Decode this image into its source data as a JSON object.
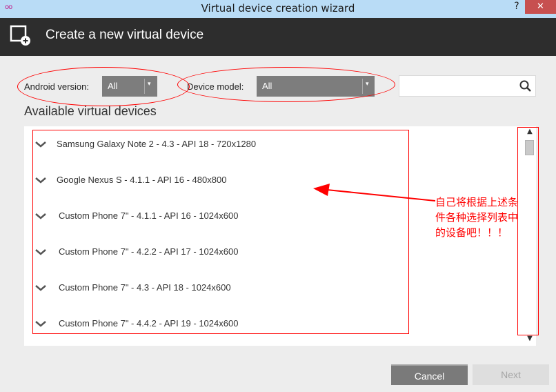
{
  "window": {
    "app_icon": "oo",
    "title": "Virtual device creation wizard",
    "help_label": "?",
    "close_label": "✕"
  },
  "header": {
    "icon": "add-device-icon",
    "title": "Create a new virtual device"
  },
  "filters": {
    "android_version": {
      "label": "Android version:",
      "value": "All"
    },
    "device_model": {
      "label": "Device model:",
      "value": "All"
    },
    "search": {
      "placeholder": "",
      "value": ""
    }
  },
  "section_title": "Available virtual devices",
  "devices": [
    {
      "label": "Samsung Galaxy Note 2 - 4.3 - API 18 - 720x1280"
    },
    {
      "label": "Google Nexus S - 4.1.1 - API 16 - 480x800"
    },
    {
      "label": "Custom Phone 7\" - 4.1.1 - API 16 - 1024x600"
    },
    {
      "label": "Custom Phone 7\" - 4.2.2 - API 17 - 1024x600"
    },
    {
      "label": "Custom Phone 7\" - 4.3 - API 18 - 1024x600"
    },
    {
      "label": "Custom Phone 7\" - 4.4.2 - API 19 - 1024x600"
    }
  ],
  "annotation": {
    "note": "自己将根据上述条件各种选择列表中的设备吧！！！",
    "color": "#ff0000"
  },
  "buttons": {
    "cancel": "Cancel",
    "next": "Next"
  },
  "colors": {
    "titlebar": "#b9dcf6",
    "header": "#2d2d2d",
    "dropdown": "#7d7d7d",
    "close": "#c75050"
  }
}
